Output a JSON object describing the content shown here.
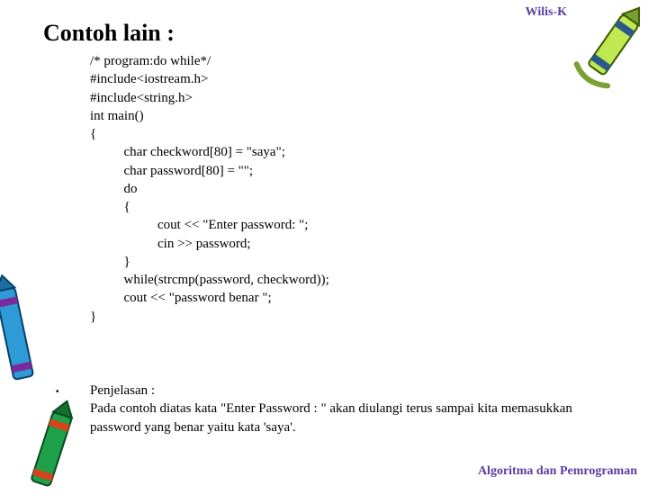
{
  "header": {
    "label": "Wilis-K"
  },
  "title": "Contoh lain :",
  "code": "/* program:do while*/\n#include<iostream.h>\n#include<string.h>\nint main()\n{\n          char checkword[80] = \"saya\";\n          char password[80] = \"\";\n          do\n          {\n                    cout << \"Enter password: \";\n                    cin >> password;\n          }\n          while(strcmp(password, checkword));\n          cout << \"password benar \";\n}",
  "explain": {
    "heading": "Penjelasan :",
    "body": "Pada contoh diatas kata \"Enter Password : \" akan diulangi terus sampai kita memasukkan password yang benar yaitu kata 'saya'."
  },
  "footer": {
    "label": "Algoritma dan Pemrograman"
  }
}
